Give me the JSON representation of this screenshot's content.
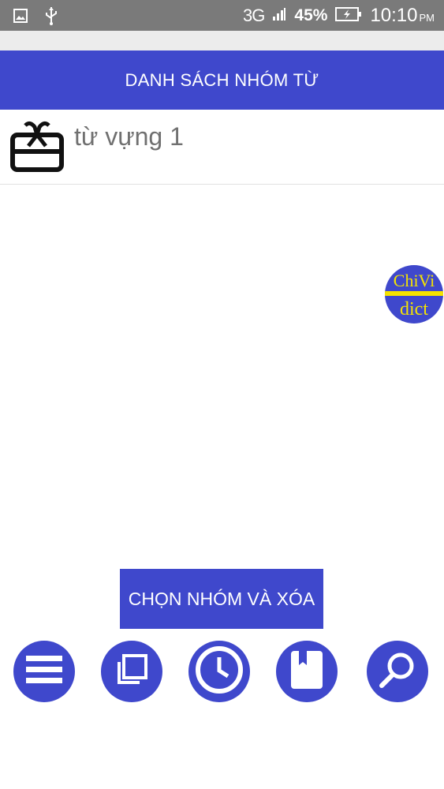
{
  "status_bar": {
    "network": "3G",
    "battery": "45%",
    "time": "10:10",
    "ampm": "PM",
    "icons": [
      "image-icon",
      "usb-icon",
      "signal-icon",
      "battery-icon"
    ]
  },
  "header": {
    "title": "DANH SÁCH NHÓM TỪ"
  },
  "groups": [
    {
      "icon": "gift-box-icon",
      "label": "từ vựng 1"
    }
  ],
  "floating_badge": {
    "top": "ChiVi",
    "bottom": "dict"
  },
  "actions": {
    "delete_label": "CHỌN NHÓM VÀ XÓA"
  },
  "bottom_nav": [
    "menu-icon",
    "copy-icon",
    "clock-icon",
    "bookmark-icon",
    "search-icon"
  ],
  "colors": {
    "primary": "#3f48cc",
    "status_bar": "#7a7a7a",
    "badge_yellow": "#f4e300"
  }
}
